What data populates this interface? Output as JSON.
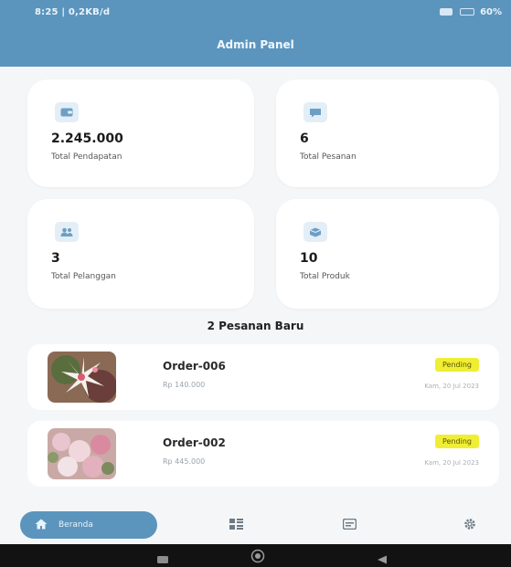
{
  "status": {
    "left": "8:25 | 0,2KB/d",
    "right": "60%"
  },
  "header": {
    "title": "Admin Panel"
  },
  "stats": [
    {
      "value": "2.245.000",
      "label": "Total Pendapatan",
      "icon": "wallet-icon"
    },
    {
      "value": "6",
      "label": "Total Pesanan",
      "icon": "chat-icon"
    },
    {
      "value": "3",
      "label": "Total Pelanggan",
      "icon": "users-icon"
    },
    {
      "value": "10",
      "label": "Total Produk",
      "icon": "box-icon"
    }
  ],
  "section_title": "2 Pesanan Baru",
  "orders": [
    {
      "id": "Order-006",
      "price": "Rp 140.000",
      "status": "Pending",
      "date": "Kam, 20 Jul 2023"
    },
    {
      "id": "Order-002",
      "price": "Rp 445.000",
      "status": "Pending",
      "date": "Kam, 20 Jul 2023"
    }
  ],
  "nav": {
    "home_label": "Beranda"
  },
  "colors": {
    "primary": "#5b95bd",
    "background": "#f4f6f8",
    "badge": "#f0ee34"
  }
}
